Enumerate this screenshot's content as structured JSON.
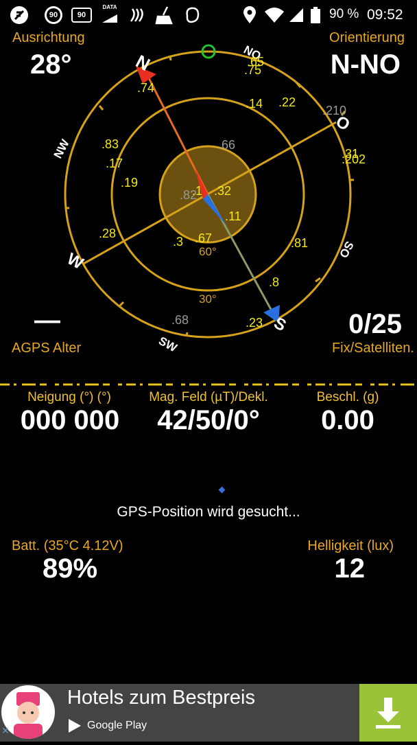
{
  "status_bar": {
    "speed_badge_1": "90",
    "speed_badge_2": "90",
    "data_label": "DATA",
    "battery_percent": "90 %",
    "time": "09:52"
  },
  "header": {
    "left_label": "Ausrichtung",
    "left_value": "28°",
    "right_label": "Orientierung",
    "right_value": "N-NO"
  },
  "compass": {
    "directions": {
      "n": "N",
      "no": "NO",
      "o": "O",
      "so": "SO",
      "s": "S",
      "sw": "SW",
      "w": "W",
      "nw": "NW"
    },
    "ring_labels": {
      "r60": "60°",
      "r30": "30°"
    },
    "satellites_yellow": [
      ".65",
      ".75",
      ".74",
      ".14",
      ".22",
      ".83",
      ".17",
      ".19",
      ".31",
      ".202",
      ".28",
      ".1",
      ".32",
      ".11",
      ".3",
      ".67",
      ".81",
      ".8",
      ".23"
    ],
    "satellites_gray": [
      ".66",
      ".82",
      ".210",
      ".68"
    ]
  },
  "agps": {
    "value": "—",
    "label": "AGPS Alter"
  },
  "fix": {
    "value": "0/25",
    "label": "Fix/Satelliten."
  },
  "sensors": {
    "tilt_label": "Neigung (°) (°)",
    "tilt_value": "000 000",
    "mag_label": "Mag. Feld (µT)/Dekl.",
    "mag_value": "42/50/0°",
    "accel_label": "Beschl. (g)",
    "accel_value": "0.00"
  },
  "gps_status": "GPS-Position wird gesucht...",
  "battery": {
    "label": "Batt. (35°C 4.12V)",
    "value": "89%"
  },
  "brightness": {
    "label": "Helligkeit (lux)",
    "value": "12"
  },
  "ad": {
    "title": "Hotels zum Bestpreis",
    "store": "Google Play"
  },
  "colors": {
    "accent_yellow": "#e9a821",
    "ring": "#d6a21a",
    "download_green": "#9bc33a"
  }
}
